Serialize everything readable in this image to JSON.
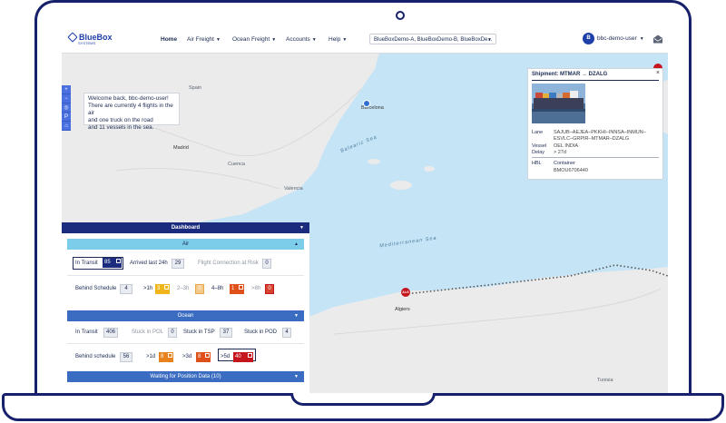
{
  "navbar": {
    "logo_name": "BlueBox",
    "logo_sub": "SYSTEMS",
    "items": [
      "Home",
      "Air Freight",
      "Ocean Freight",
      "Accounts",
      "Help"
    ],
    "dataset": "BlueBoxDemo-A, BlueBoxDemo-B, BlueBoxDe...",
    "avatar_initial": "B",
    "user": "bbc-demo-user"
  },
  "map": {
    "zoom_controls": [
      "+",
      "−",
      "◎",
      "P",
      "⌂"
    ],
    "welcome": [
      "Welcome back, bbc-demo-user!",
      "There are currently 4 flights in the air",
      "and one truck on the road",
      "and 11 vessels in the sea."
    ],
    "places": {
      "spain": "Spain",
      "madrid": "Madrid",
      "barcelona": "Barcelona",
      "valencia": "Valencia",
      "cuenca": "Cuenca",
      "algiers": "Algiers",
      "tunisia": "Tunisia"
    },
    "seas": {
      "balearic": "Balearic Sea",
      "mediterranean": "Mediterranean Sea"
    },
    "pin_label": "ALG"
  },
  "shipment": {
    "title": "Shipment: MTMAR → DZALG",
    "lane_label": "Lane",
    "lane": "SAJUB–AEJEA–PKKHI–INNSA–INMUN–ESVLC–GRPIR–MTMAR–DZALG",
    "vessel_label": "Vessel",
    "vessel": "OEL INDIA",
    "delay_label": "Delay",
    "delay": "> 27d",
    "hbl_label": "HBL",
    "hbl_type": "Container",
    "hbl": "BMOU6706440"
  },
  "dashboard": {
    "title": "Dashboard",
    "air": {
      "title": "Air",
      "in_transit_label": "In Transit",
      "in_transit": "85",
      "arrived_label": "Arrived last 24h",
      "arrived": "29",
      "risk_label": "Flight Connection at Risk",
      "risk": "0",
      "behind_label": "Behind Schedule",
      "behind": "4",
      "gt1h_label": ">1h",
      "gt1h": "3",
      "h2_3_label": "2–3h",
      "h2_3": "0",
      "h4_8_label": "4–8h",
      "h4_8": "1",
      "gt8h_label": ">8h",
      "gt8h": "0"
    },
    "ocean": {
      "title": "Ocean",
      "in_transit_label": "In Transit",
      "in_transit": "406",
      "stuck_pol_label": "Stuck in POL",
      "stuck_pol": "0",
      "stuck_tsp_label": "Stuck in TSP",
      "stuck_tsp": "37",
      "stuck_pod_label": "Stuck in POD",
      "stuck_pod": "4",
      "behind_label": "Behind schedule",
      "behind": "56",
      "gt1d_label": ">1d",
      "gt1d": "8",
      "gt3d_label": ">3d",
      "gt3d": "8",
      "gt5d_label": ">5d",
      "gt5d": "40"
    },
    "waiting": "Waiting for Position Data (10)"
  },
  "colors": {
    "frame": "#17206b",
    "dashboard_header": "#1b2c7e",
    "air": "#7bcdea",
    "ocean": "#3a6cc1",
    "yellow": "#f1b51c",
    "orange": "#e8821e",
    "red_orange": "#e0501a",
    "red": "#c4161c"
  }
}
